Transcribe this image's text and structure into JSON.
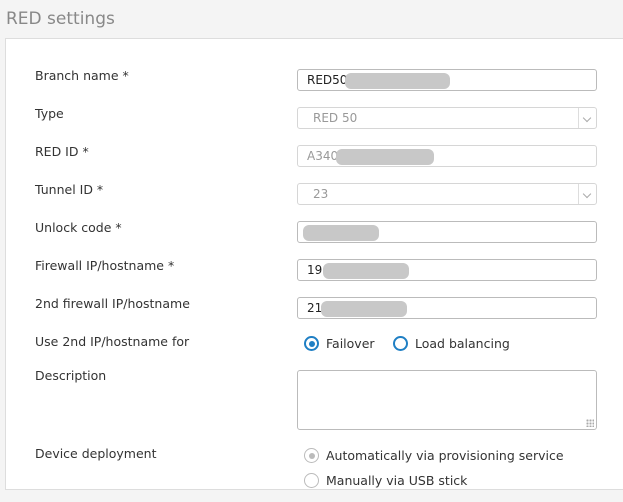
{
  "page": {
    "title": "RED settings"
  },
  "form": {
    "branch_name": {
      "label": "Branch name *",
      "value": "RED50"
    },
    "type": {
      "label": "Type",
      "value": "RED 50"
    },
    "red_id": {
      "label": "RED ID *",
      "value": "A340"
    },
    "tunnel_id": {
      "label": "Tunnel ID *",
      "value": "23"
    },
    "unlock_code": {
      "label": "Unlock code *",
      "value": ""
    },
    "firewall_ip": {
      "label": "Firewall IP/hostname *",
      "value": "19"
    },
    "second_firewall_ip": {
      "label": "2nd firewall IP/hostname",
      "value": "21"
    },
    "use_2nd_ip": {
      "label": "Use 2nd IP/hostname for",
      "options": [
        "Failover",
        "Load balancing"
      ],
      "selected": "Failover"
    },
    "description": {
      "label": "Description",
      "value": ""
    },
    "device_deployment": {
      "label": "Device deployment",
      "options": [
        "Automatically via provisioning service",
        "Manually via USB stick"
      ],
      "selected": "Automatically via provisioning service"
    }
  },
  "colors": {
    "accent": "#1f7fc4",
    "redaction": "#c8c8c8"
  }
}
